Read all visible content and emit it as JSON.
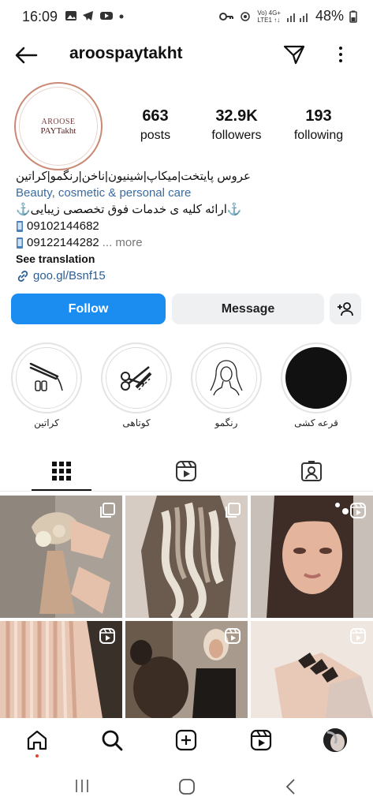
{
  "status_bar": {
    "time": "16:09",
    "net_label": "Vo) 4G+\nLTE1 ↑↓",
    "battery": "48%"
  },
  "header": {
    "username": "aroospaytakht"
  },
  "profile": {
    "avatar_text_line1": "AROOSE",
    "avatar_text_line2": "PAYTakht",
    "stats": [
      {
        "value": "663",
        "label": "posts"
      },
      {
        "value": "32.9K",
        "label": "followers"
      },
      {
        "value": "193",
        "label": "following"
      }
    ],
    "bio": {
      "line1": "عروس پایتخت|میکاپ|شینیون|ناخن|رنگمو|کراتین",
      "category": "Beauty, cosmetic & personal care",
      "line3": "⚓ارائه کلیه ی خدمات فوق تخصصی زیبایی⚓",
      "phone1": "09102144682",
      "phone2": "09122144282",
      "more": "... more",
      "see_translation": "See translation",
      "link": "goo.gl/Bsnf15"
    }
  },
  "actions": {
    "follow": "Follow",
    "message": "Message"
  },
  "highlights": [
    {
      "label": "کراتین",
      "icon": "hair-straightener-icon"
    },
    {
      "label": "کوتاهی",
      "icon": "scissors-comb-icon"
    },
    {
      "label": "رنگمو",
      "icon": "woman-sketch-icon"
    },
    {
      "label": "قرعه کشی",
      "icon": "black-circle-icon"
    }
  ],
  "colors": {
    "accent": "#1b8cf0",
    "link": "#2c5e96",
    "avatar_ring": "#c98a75"
  }
}
